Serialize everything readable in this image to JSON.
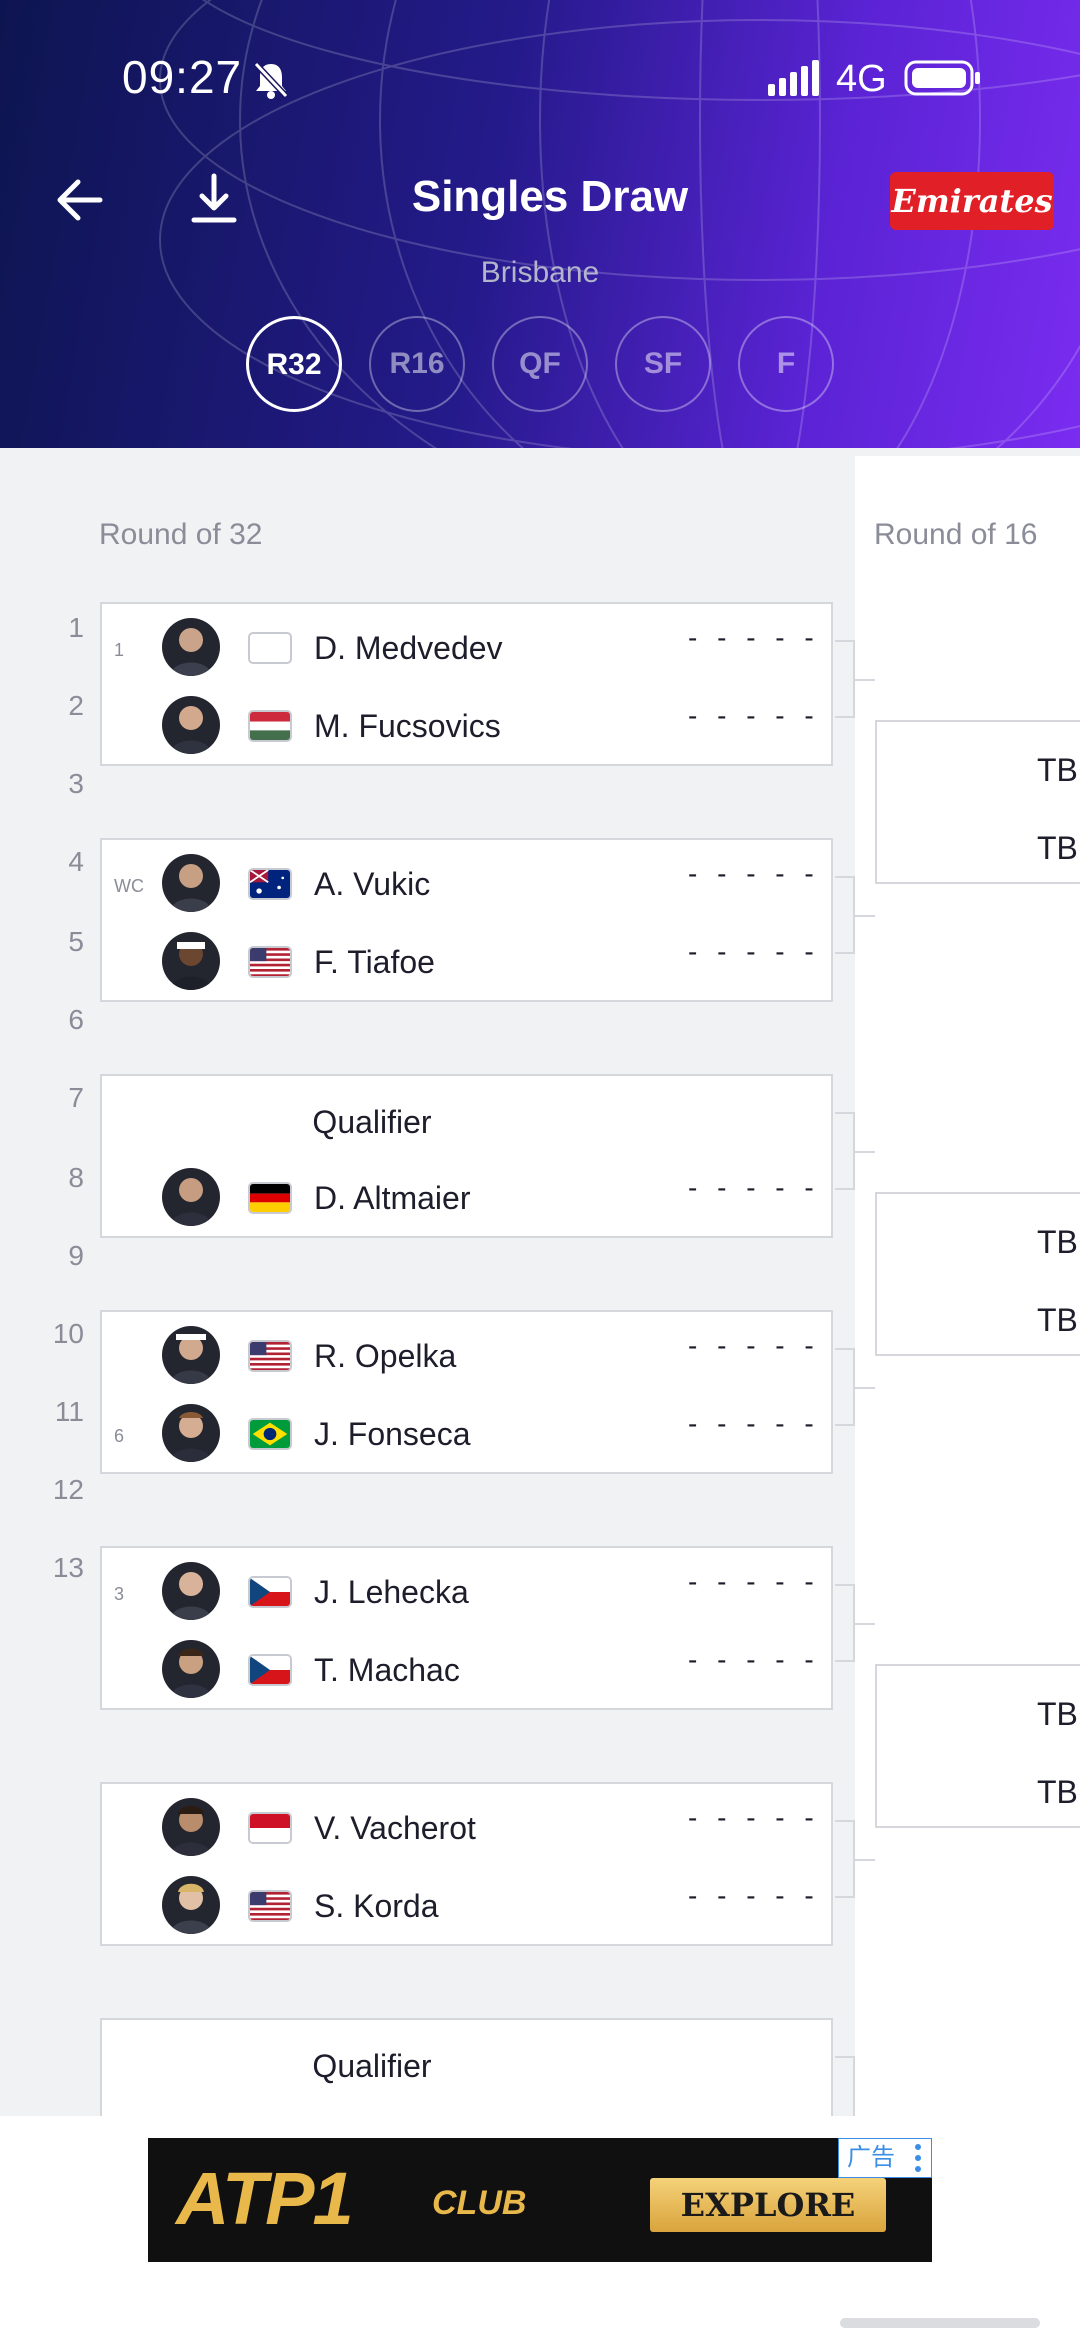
{
  "status_bar": {
    "time": "09:27",
    "network": "4G"
  },
  "header": {
    "title": "Singles Draw",
    "subtitle": "Brisbane",
    "sponsor": "Emirates",
    "rounds": [
      "R32",
      "R16",
      "QF",
      "SF",
      "F"
    ],
    "active_round": "R32"
  },
  "draw": {
    "col_r32_title": "Round of 32",
    "col_r16_title": "Round of 16",
    "positions": [
      "1",
      "2",
      "3",
      "4",
      "5",
      "6",
      "7",
      "8",
      "9",
      "10",
      "11",
      "12",
      "13"
    ],
    "matches": [
      {
        "players": [
          {
            "seed": "1",
            "name": "D. Medvedev",
            "flag": "none",
            "score": "- - - - -"
          },
          {
            "seed": "",
            "name": "M. Fucsovics",
            "flag": "hungary",
            "score": "- - - - -"
          }
        ]
      },
      {
        "players": [
          {
            "seed": "WC",
            "name": "A. Vukic",
            "flag": "australia",
            "score": "- - - - -"
          },
          {
            "seed": "",
            "name": "F. Tiafoe",
            "flag": "usa",
            "score": "- - - - -"
          }
        ]
      },
      {
        "players": [
          {
            "qualifier": "Qualifier"
          },
          {
            "seed": "",
            "name": "D. Altmaier",
            "flag": "germany",
            "score": "- - - - -"
          }
        ]
      },
      {
        "players": [
          {
            "seed": "",
            "name": "R. Opelka",
            "flag": "usa",
            "score": "- - - - -"
          },
          {
            "seed": "6",
            "name": "J. Fonseca",
            "flag": "brazil",
            "score": "- - - - -"
          }
        ]
      },
      {
        "players": [
          {
            "seed": "3",
            "name": "J. Lehecka",
            "flag": "czech",
            "score": "- - - - -"
          },
          {
            "seed": "",
            "name": "T. Machac",
            "flag": "czech",
            "score": "- - - - -"
          }
        ]
      },
      {
        "players": [
          {
            "seed": "",
            "name": "V. Vacherot",
            "flag": "monaco",
            "score": "- - - - -"
          },
          {
            "seed": "",
            "name": "S. Korda",
            "flag": "usa",
            "score": "- - - - -"
          }
        ]
      },
      {
        "players": [
          {
            "qualifier": "Qualifier"
          }
        ]
      }
    ],
    "r16_slots": [
      "TB",
      "TB"
    ]
  },
  "ad": {
    "logo": "ATP1",
    "club": "CLUB",
    "cta": "EXPLORE",
    "tag": "广告"
  },
  "colors": {
    "accent": "#5a23d4",
    "sponsor": "#e01f26",
    "border": "#d5d7dd"
  }
}
